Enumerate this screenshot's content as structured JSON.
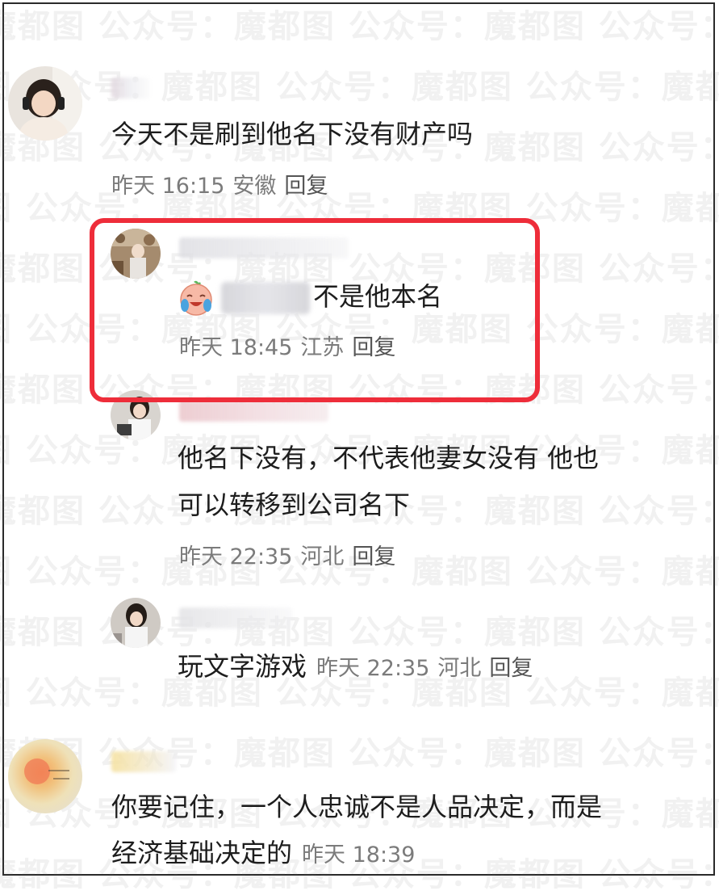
{
  "watermark": "魔都图  公众号：",
  "comments": [
    {
      "text": "今天不是刷到他名下没有财产吗",
      "time": "昨天 16:15",
      "location": "安徽",
      "reply": "回复"
    },
    {
      "text": "不是他本名",
      "time": "昨天 18:45",
      "location": "江苏",
      "reply": "回复"
    },
    {
      "text_line1": "他名下没有，不代表他妻女没有 他也",
      "text_line2": "可以转移到公司名下",
      "time": "昨天 22:35",
      "location": "河北",
      "reply": "回复"
    },
    {
      "text": "玩文字游戏",
      "time": "昨天 22:35",
      "location": "河北",
      "reply": "回复"
    },
    {
      "text_line1": "你要记住，一个人忠诚不是人品决定，而是",
      "text_line2": "经济基础决定的",
      "time": "昨天 18:39"
    }
  ],
  "icons": {
    "emoji": "laughing-crying-emoji-icon"
  },
  "colors": {
    "highlight_border": "#ee2d3a",
    "meta_text": "#7b7b7b",
    "body_text": "#1d1d1d"
  }
}
